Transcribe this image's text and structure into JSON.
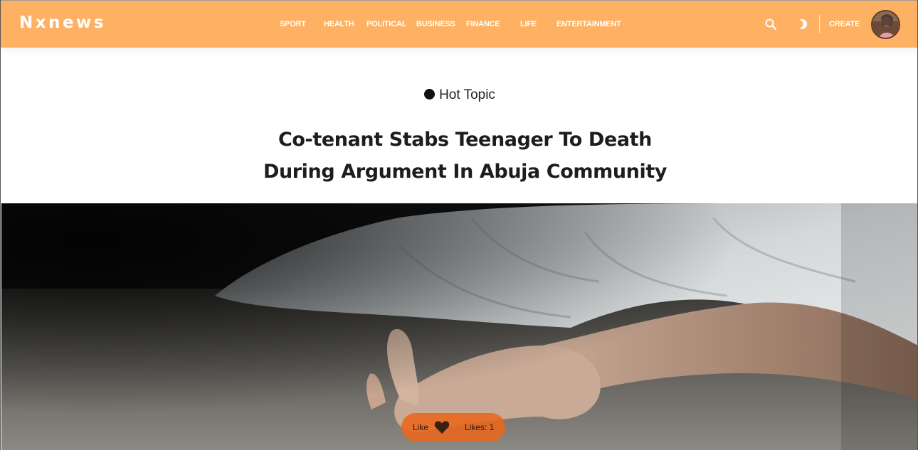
{
  "header": {
    "brand": "Nxnews",
    "nav": [
      "SPORT",
      "HEALTH",
      "POLITICAL",
      "BUSINESS",
      "FINANCE",
      "LIFE",
      "ENTERTAINMENT"
    ],
    "create_label": "CREATE",
    "icons": {
      "search": "search-icon",
      "theme": "moon-icon",
      "avatar": "user-avatar"
    }
  },
  "article": {
    "category": "Hot Topic",
    "title": "Co-tenant Stabs Teenager To Death During Argument In Abuja Community"
  },
  "reactions": {
    "like_label": "Like",
    "likes_text": "Likes: 1"
  },
  "colors": {
    "header_bg": "#ffb163",
    "like_pill": "#e8661c"
  }
}
